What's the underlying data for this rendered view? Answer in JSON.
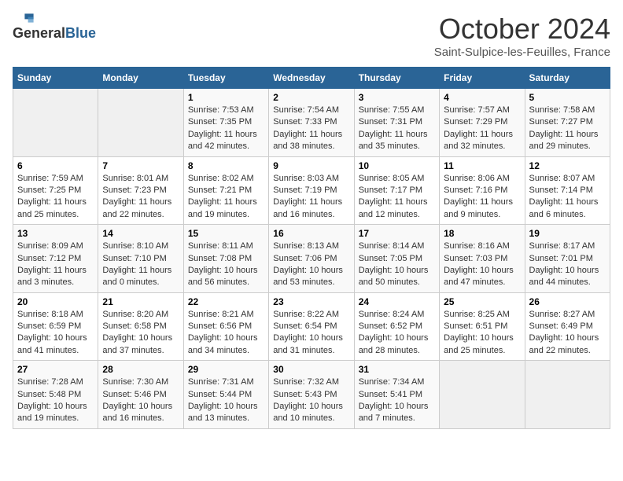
{
  "header": {
    "logo_line1": "General",
    "logo_line2": "Blue",
    "month_title": "October 2024",
    "location": "Saint-Sulpice-les-Feuilles, France"
  },
  "days_of_week": [
    "Sunday",
    "Monday",
    "Tuesday",
    "Wednesday",
    "Thursday",
    "Friday",
    "Saturday"
  ],
  "weeks": [
    [
      {
        "day": "",
        "sunrise": "",
        "sunset": "",
        "daylight": ""
      },
      {
        "day": "",
        "sunrise": "",
        "sunset": "",
        "daylight": ""
      },
      {
        "day": "1",
        "sunrise": "Sunrise: 7:53 AM",
        "sunset": "Sunset: 7:35 PM",
        "daylight": "Daylight: 11 hours and 42 minutes."
      },
      {
        "day": "2",
        "sunrise": "Sunrise: 7:54 AM",
        "sunset": "Sunset: 7:33 PM",
        "daylight": "Daylight: 11 hours and 38 minutes."
      },
      {
        "day": "3",
        "sunrise": "Sunrise: 7:55 AM",
        "sunset": "Sunset: 7:31 PM",
        "daylight": "Daylight: 11 hours and 35 minutes."
      },
      {
        "day": "4",
        "sunrise": "Sunrise: 7:57 AM",
        "sunset": "Sunset: 7:29 PM",
        "daylight": "Daylight: 11 hours and 32 minutes."
      },
      {
        "day": "5",
        "sunrise": "Sunrise: 7:58 AM",
        "sunset": "Sunset: 7:27 PM",
        "daylight": "Daylight: 11 hours and 29 minutes."
      }
    ],
    [
      {
        "day": "6",
        "sunrise": "Sunrise: 7:59 AM",
        "sunset": "Sunset: 7:25 PM",
        "daylight": "Daylight: 11 hours and 25 minutes."
      },
      {
        "day": "7",
        "sunrise": "Sunrise: 8:01 AM",
        "sunset": "Sunset: 7:23 PM",
        "daylight": "Daylight: 11 hours and 22 minutes."
      },
      {
        "day": "8",
        "sunrise": "Sunrise: 8:02 AM",
        "sunset": "Sunset: 7:21 PM",
        "daylight": "Daylight: 11 hours and 19 minutes."
      },
      {
        "day": "9",
        "sunrise": "Sunrise: 8:03 AM",
        "sunset": "Sunset: 7:19 PM",
        "daylight": "Daylight: 11 hours and 16 minutes."
      },
      {
        "day": "10",
        "sunrise": "Sunrise: 8:05 AM",
        "sunset": "Sunset: 7:17 PM",
        "daylight": "Daylight: 11 hours and 12 minutes."
      },
      {
        "day": "11",
        "sunrise": "Sunrise: 8:06 AM",
        "sunset": "Sunset: 7:16 PM",
        "daylight": "Daylight: 11 hours and 9 minutes."
      },
      {
        "day": "12",
        "sunrise": "Sunrise: 8:07 AM",
        "sunset": "Sunset: 7:14 PM",
        "daylight": "Daylight: 11 hours and 6 minutes."
      }
    ],
    [
      {
        "day": "13",
        "sunrise": "Sunrise: 8:09 AM",
        "sunset": "Sunset: 7:12 PM",
        "daylight": "Daylight: 11 hours and 3 minutes."
      },
      {
        "day": "14",
        "sunrise": "Sunrise: 8:10 AM",
        "sunset": "Sunset: 7:10 PM",
        "daylight": "Daylight: 11 hours and 0 minutes."
      },
      {
        "day": "15",
        "sunrise": "Sunrise: 8:11 AM",
        "sunset": "Sunset: 7:08 PM",
        "daylight": "Daylight: 10 hours and 56 minutes."
      },
      {
        "day": "16",
        "sunrise": "Sunrise: 8:13 AM",
        "sunset": "Sunset: 7:06 PM",
        "daylight": "Daylight: 10 hours and 53 minutes."
      },
      {
        "day": "17",
        "sunrise": "Sunrise: 8:14 AM",
        "sunset": "Sunset: 7:05 PM",
        "daylight": "Daylight: 10 hours and 50 minutes."
      },
      {
        "day": "18",
        "sunrise": "Sunrise: 8:16 AM",
        "sunset": "Sunset: 7:03 PM",
        "daylight": "Daylight: 10 hours and 47 minutes."
      },
      {
        "day": "19",
        "sunrise": "Sunrise: 8:17 AM",
        "sunset": "Sunset: 7:01 PM",
        "daylight": "Daylight: 10 hours and 44 minutes."
      }
    ],
    [
      {
        "day": "20",
        "sunrise": "Sunrise: 8:18 AM",
        "sunset": "Sunset: 6:59 PM",
        "daylight": "Daylight: 10 hours and 41 minutes."
      },
      {
        "day": "21",
        "sunrise": "Sunrise: 8:20 AM",
        "sunset": "Sunset: 6:58 PM",
        "daylight": "Daylight: 10 hours and 37 minutes."
      },
      {
        "day": "22",
        "sunrise": "Sunrise: 8:21 AM",
        "sunset": "Sunset: 6:56 PM",
        "daylight": "Daylight: 10 hours and 34 minutes."
      },
      {
        "day": "23",
        "sunrise": "Sunrise: 8:22 AM",
        "sunset": "Sunset: 6:54 PM",
        "daylight": "Daylight: 10 hours and 31 minutes."
      },
      {
        "day": "24",
        "sunrise": "Sunrise: 8:24 AM",
        "sunset": "Sunset: 6:52 PM",
        "daylight": "Daylight: 10 hours and 28 minutes."
      },
      {
        "day": "25",
        "sunrise": "Sunrise: 8:25 AM",
        "sunset": "Sunset: 6:51 PM",
        "daylight": "Daylight: 10 hours and 25 minutes."
      },
      {
        "day": "26",
        "sunrise": "Sunrise: 8:27 AM",
        "sunset": "Sunset: 6:49 PM",
        "daylight": "Daylight: 10 hours and 22 minutes."
      }
    ],
    [
      {
        "day": "27",
        "sunrise": "Sunrise: 7:28 AM",
        "sunset": "Sunset: 5:48 PM",
        "daylight": "Daylight: 10 hours and 19 minutes."
      },
      {
        "day": "28",
        "sunrise": "Sunrise: 7:30 AM",
        "sunset": "Sunset: 5:46 PM",
        "daylight": "Daylight: 10 hours and 16 minutes."
      },
      {
        "day": "29",
        "sunrise": "Sunrise: 7:31 AM",
        "sunset": "Sunset: 5:44 PM",
        "daylight": "Daylight: 10 hours and 13 minutes."
      },
      {
        "day": "30",
        "sunrise": "Sunrise: 7:32 AM",
        "sunset": "Sunset: 5:43 PM",
        "daylight": "Daylight: 10 hours and 10 minutes."
      },
      {
        "day": "31",
        "sunrise": "Sunrise: 7:34 AM",
        "sunset": "Sunset: 5:41 PM",
        "daylight": "Daylight: 10 hours and 7 minutes."
      },
      {
        "day": "",
        "sunrise": "",
        "sunset": "",
        "daylight": ""
      },
      {
        "day": "",
        "sunrise": "",
        "sunset": "",
        "daylight": ""
      }
    ]
  ]
}
